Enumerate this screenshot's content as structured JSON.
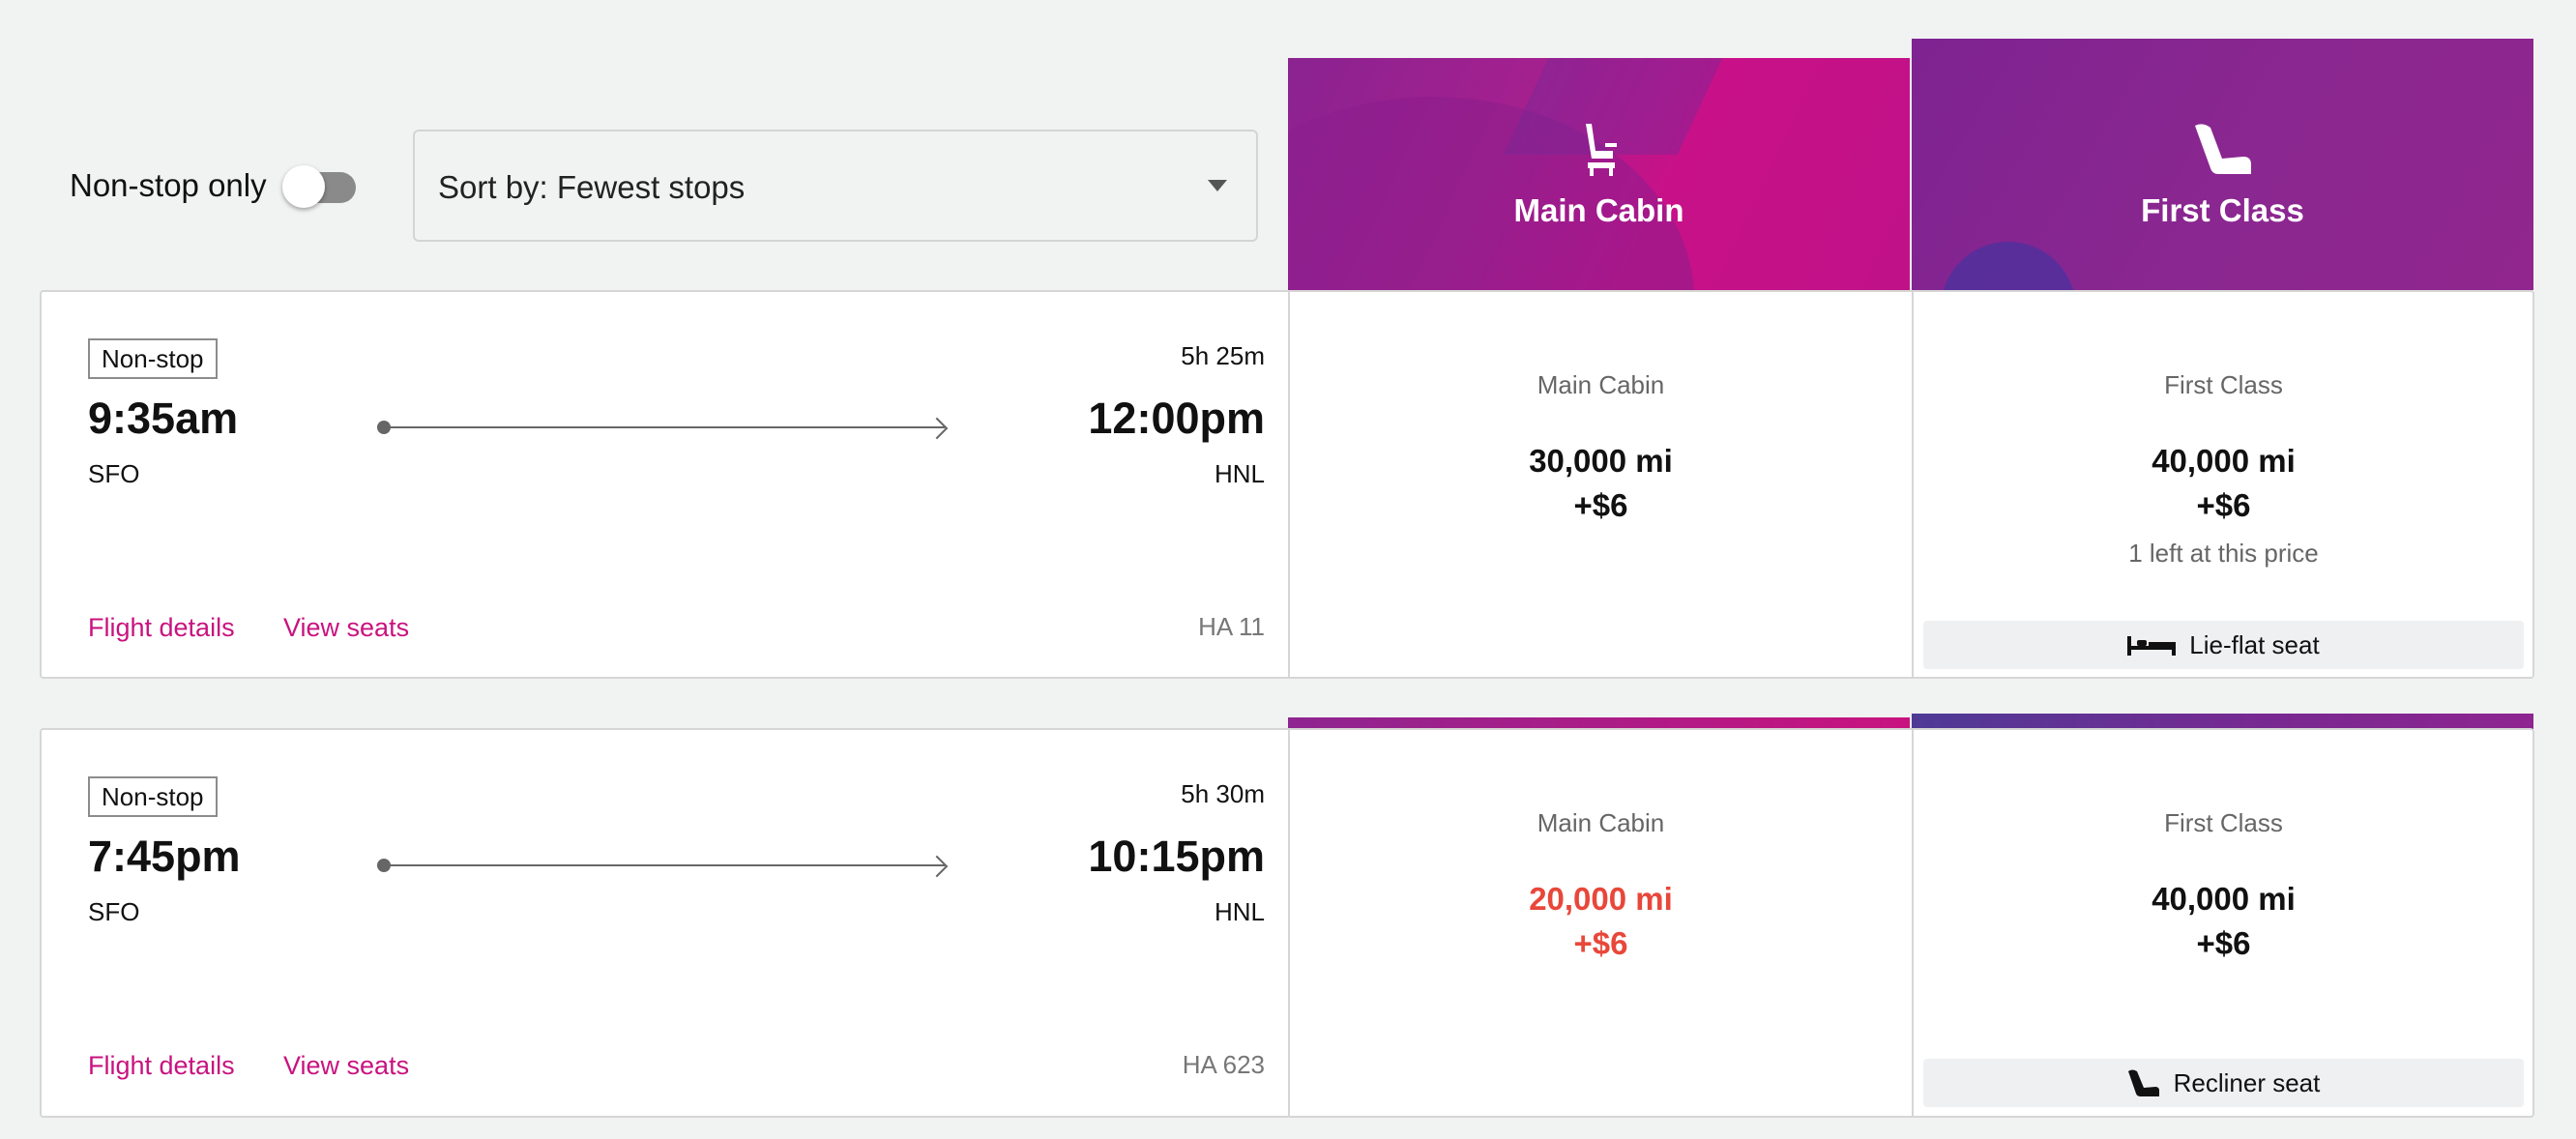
{
  "filters": {
    "nonstop_label": "Non-stop only",
    "nonstop_on": false,
    "sort_value": "Sort by: Fewest stops"
  },
  "cabins": [
    {
      "title": "Main Cabin",
      "icon": "seat-icon",
      "color": "#c41389"
    },
    {
      "title": "First Class",
      "icon": "recliner-seat-icon",
      "color": "#862592"
    }
  ],
  "flights": [
    {
      "stops": "Non-stop",
      "duration": "5h 25m",
      "depart_time": "9:35am",
      "depart_airport": "SFO",
      "arrive_time": "12:00pm",
      "arrive_airport": "HNL",
      "details_link": "Flight details",
      "seats_link": "View seats",
      "flight_number": "HA 11",
      "fares": [
        {
          "cabin": "Main Cabin",
          "miles": "30,000 mi",
          "fee": "+$6"
        },
        {
          "cabin": "First Class",
          "miles": "40,000 mi",
          "fee": "+$6",
          "note": "1 left at this price",
          "seat_type": "Lie-flat seat",
          "seat_icon": "bed-icon"
        }
      ]
    },
    {
      "stops": "Non-stop",
      "duration": "5h 30m",
      "depart_time": "7:45pm",
      "depart_airport": "SFO",
      "arrive_time": "10:15pm",
      "arrive_airport": "HNL",
      "details_link": "Flight details",
      "seats_link": "View seats",
      "flight_number": "HA 623",
      "fares": [
        {
          "cabin": "Main Cabin",
          "miles": "20,000 mi",
          "fee": "+$6",
          "sale_color": "#e8473a"
        },
        {
          "cabin": "First Class",
          "miles": "40,000 mi",
          "fee": "+$6",
          "seat_type": "Recliner seat",
          "seat_icon": "recliner-seat-icon"
        }
      ]
    }
  ],
  "colors": {
    "link": "#c8137f",
    "sale": "#e8473a",
    "background": "#f1f2f2"
  }
}
